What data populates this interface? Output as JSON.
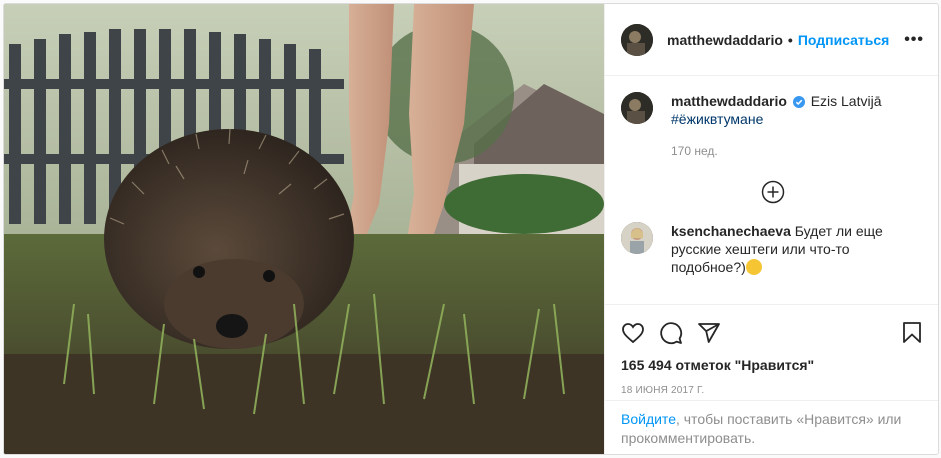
{
  "post": {
    "username": "matthewdaddario",
    "separator": "•",
    "follow_label": "Подписаться",
    "more_label": "•••",
    "photo_icon": "hedgehog-photo"
  },
  "caption": {
    "username": "matthewdaddario",
    "location": "Ezis Latvijā",
    "hashtag": "#ёжиквтумане",
    "time_ago": "170 нед."
  },
  "load_more_icon": "plus-circle-icon",
  "comments": [
    {
      "username": "ksenchanechaeva",
      "text": "Будет ли еще русские хештеги или что-то подобное?)",
      "emoji": "grinning-face"
    }
  ],
  "actions": {
    "icons": [
      "heart-icon",
      "comment-icon",
      "share-icon",
      "bookmark-icon"
    ],
    "likes": "165 494 отметок \"Нравится\"",
    "date": "18 июня 2017 г."
  },
  "login_prompt": {
    "link": "Войдите",
    "text": ", чтобы поставить «Нравится» или прокомментировать."
  },
  "colors": {
    "accent": "#0095f6",
    "hashtag": "#00376b",
    "muted": "#8e8e8e",
    "verified": "#3897f0"
  }
}
